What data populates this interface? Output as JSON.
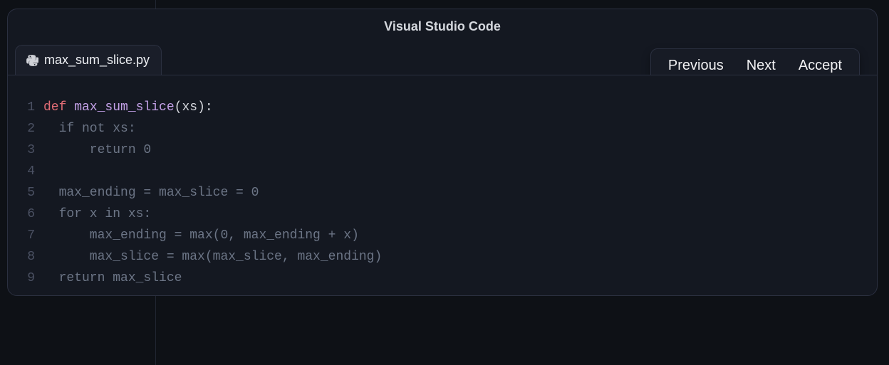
{
  "window_title": "Visual Studio Code",
  "tab": {
    "label": "max_sum_slice.py",
    "icon": "python-icon"
  },
  "actions": {
    "prev_label": "Previous",
    "next_label": "Next",
    "accept_label": "Accept"
  },
  "code": {
    "line_numbers": [
      "1",
      "2",
      "3",
      "4",
      "5",
      "6",
      "7",
      "8",
      "9"
    ],
    "line1": {
      "def": "def",
      "name": "max_sum_slice",
      "open": "(",
      "param": "xs",
      "close": ")",
      "colon": ":"
    },
    "line2": "  if not xs:",
    "line3": "      return 0",
    "line4": "",
    "line5": "  max_ending = max_slice = 0",
    "line6": "  for x in xs:",
    "line7": "      max_ending = max(0, max_ending + x)",
    "line8": "      max_slice = max(max_slice, max_ending)",
    "line9": "  return max_slice"
  }
}
